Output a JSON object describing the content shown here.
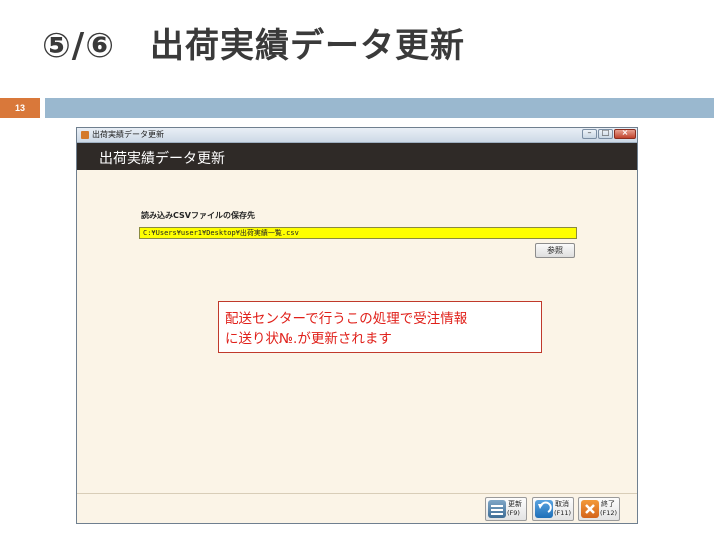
{
  "slide": {
    "title": "⑤/⑥　出荷実績データ更新",
    "page_number": "13",
    "accent_color": "#d9783a",
    "bar_color": "#9ab8cf"
  },
  "window": {
    "title": "出荷実績データ更新",
    "controls": {
      "minimize": "–",
      "maximize": "□",
      "close": "×"
    }
  },
  "app_header": {
    "title": "出荷実績データ更新"
  },
  "form": {
    "csv_label": "読み込みCSVファイルの保存先",
    "csv_path": "C:¥Users¥user1¥Desktop¥出荷実績一覧.csv",
    "browse_label": "参照",
    "path_highlight_color": "#ffff00"
  },
  "note": {
    "line1": "配送センターで行うこの処理で受注情報",
    "line2": "に送り状№.が更新されます",
    "text_color": "#e0201a"
  },
  "footer": {
    "update_label": "更新",
    "update_key": "(F9)",
    "cancel_label": "取消",
    "cancel_key": "(F11)",
    "exit_label": "終了",
    "exit_key": "(F12)"
  },
  "icons": {
    "app": "app-icon",
    "update": "update-icon",
    "cancel": "undo-icon",
    "exit": "close-icon"
  }
}
